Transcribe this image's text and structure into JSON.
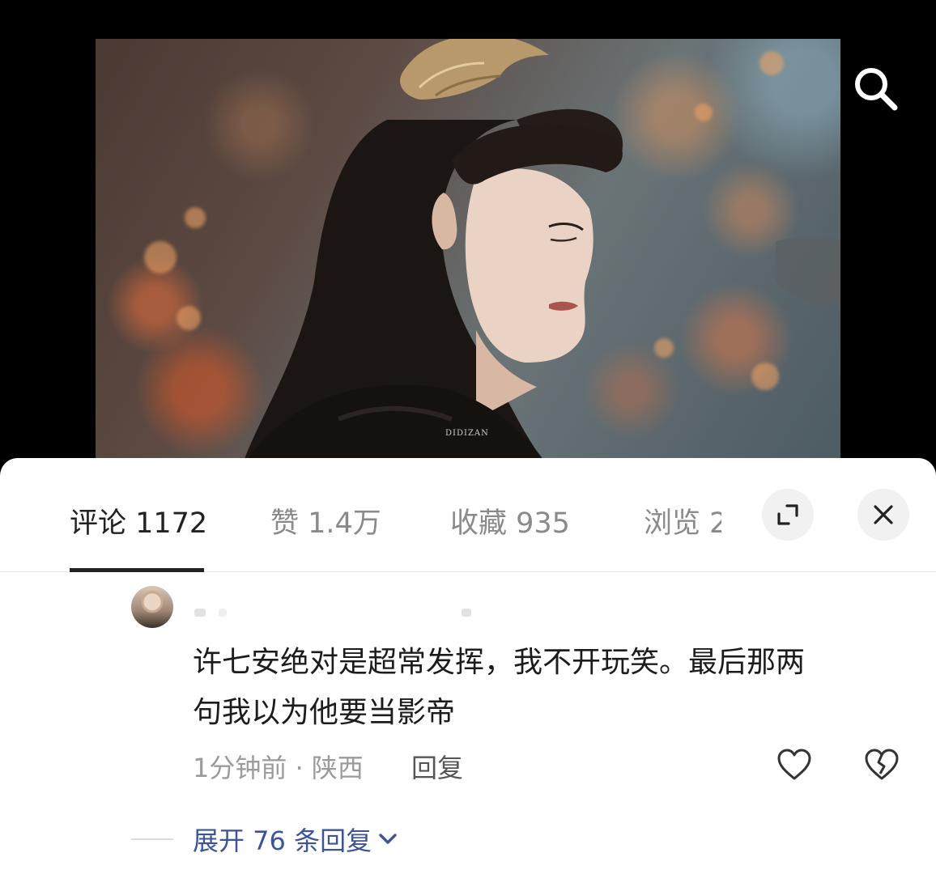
{
  "image": {
    "watermark": "DIDIZAN"
  },
  "icons": {
    "search": "search-icon",
    "fullscreen": "fullscreen-exit-icon",
    "close": "close-icon",
    "like": "heart-outline-icon",
    "dislike": "broken-heart-icon",
    "expand": "chevron-down-icon"
  },
  "tabs": [
    {
      "label": "评论 1172",
      "active": true
    },
    {
      "label": "赞 1.4万",
      "active": false
    },
    {
      "label": "收藏 935",
      "active": false
    },
    {
      "label": "浏览 2",
      "active": false
    }
  ],
  "comment": {
    "text_line1": "许七安绝对是超常发挥，我不开玩笑。最后那两",
    "text_line2": "句我以为他要当影帝",
    "time_location": "1分钟前 · 陕西",
    "reply_label": "回复",
    "expand_label": "展开 76 条回复"
  },
  "colors": {
    "link": "#3b5598",
    "active_tab": "#222222",
    "inactive_tab": "#8a8a8a"
  }
}
